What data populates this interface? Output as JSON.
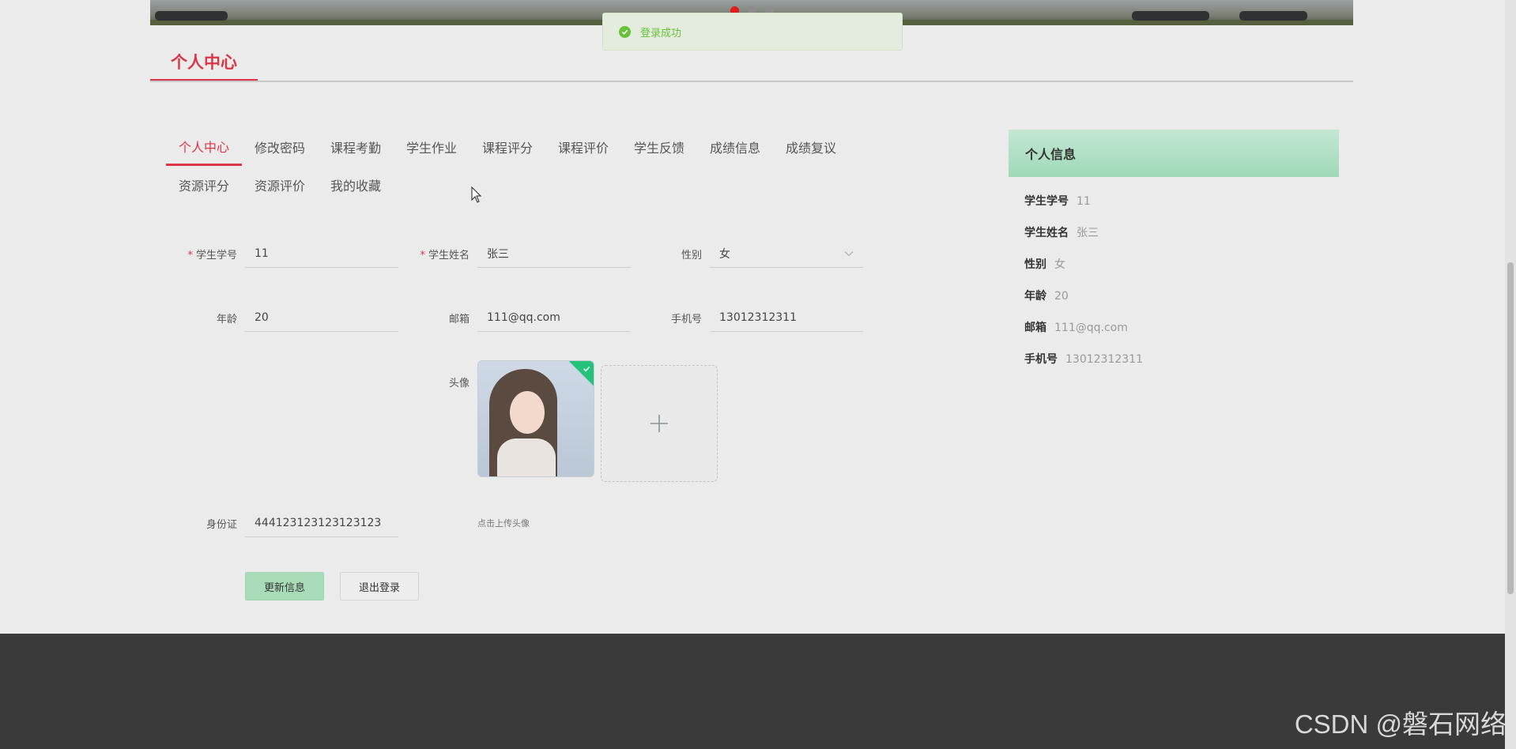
{
  "toast": {
    "message": "登录成功",
    "icon": "check-circle-icon",
    "color": "#67c23a"
  },
  "page": {
    "title": "个人中心",
    "accent": "#dc3545"
  },
  "tabs": [
    {
      "label": "个人中心",
      "active": true
    },
    {
      "label": "修改密码"
    },
    {
      "label": "课程考勤"
    },
    {
      "label": "学生作业"
    },
    {
      "label": "课程评分"
    },
    {
      "label": "课程评价"
    },
    {
      "label": "学生反馈"
    },
    {
      "label": "成绩信息"
    },
    {
      "label": "成绩复议"
    },
    {
      "label": "资源评分"
    },
    {
      "label": "资源评价"
    },
    {
      "label": "我的收藏"
    }
  ],
  "form": {
    "student_no": {
      "label": "学生学号",
      "value": "11",
      "required_mark": "*"
    },
    "student_name": {
      "label": "学生姓名",
      "value": "张三",
      "required_mark": "*"
    },
    "gender": {
      "label": "性别",
      "value": "女",
      "icon": "chevron-down-icon"
    },
    "age": {
      "label": "年龄",
      "value": "20"
    },
    "email": {
      "label": "邮箱",
      "value": "111@qq.com"
    },
    "phone": {
      "label": "手机号",
      "value": "13012312311"
    },
    "avatar": {
      "label": "头像",
      "hint": "点击上传头像",
      "upload_icon": "plus-icon"
    },
    "id_card": {
      "label": "身份证",
      "value": "444123123123123123"
    }
  },
  "buttons": {
    "update": "更新信息",
    "logout": "退出登录"
  },
  "info": {
    "title": "个人信息",
    "rows": [
      {
        "key": "学生学号",
        "value": "11"
      },
      {
        "key": "学生姓名",
        "value": "张三"
      },
      {
        "key": "性别",
        "value": "女"
      },
      {
        "key": "年龄",
        "value": "20"
      },
      {
        "key": "邮箱",
        "value": "111@qq.com"
      },
      {
        "key": "手机号",
        "value": "13012312311"
      }
    ]
  },
  "watermark": "CSDN @磐石网络"
}
